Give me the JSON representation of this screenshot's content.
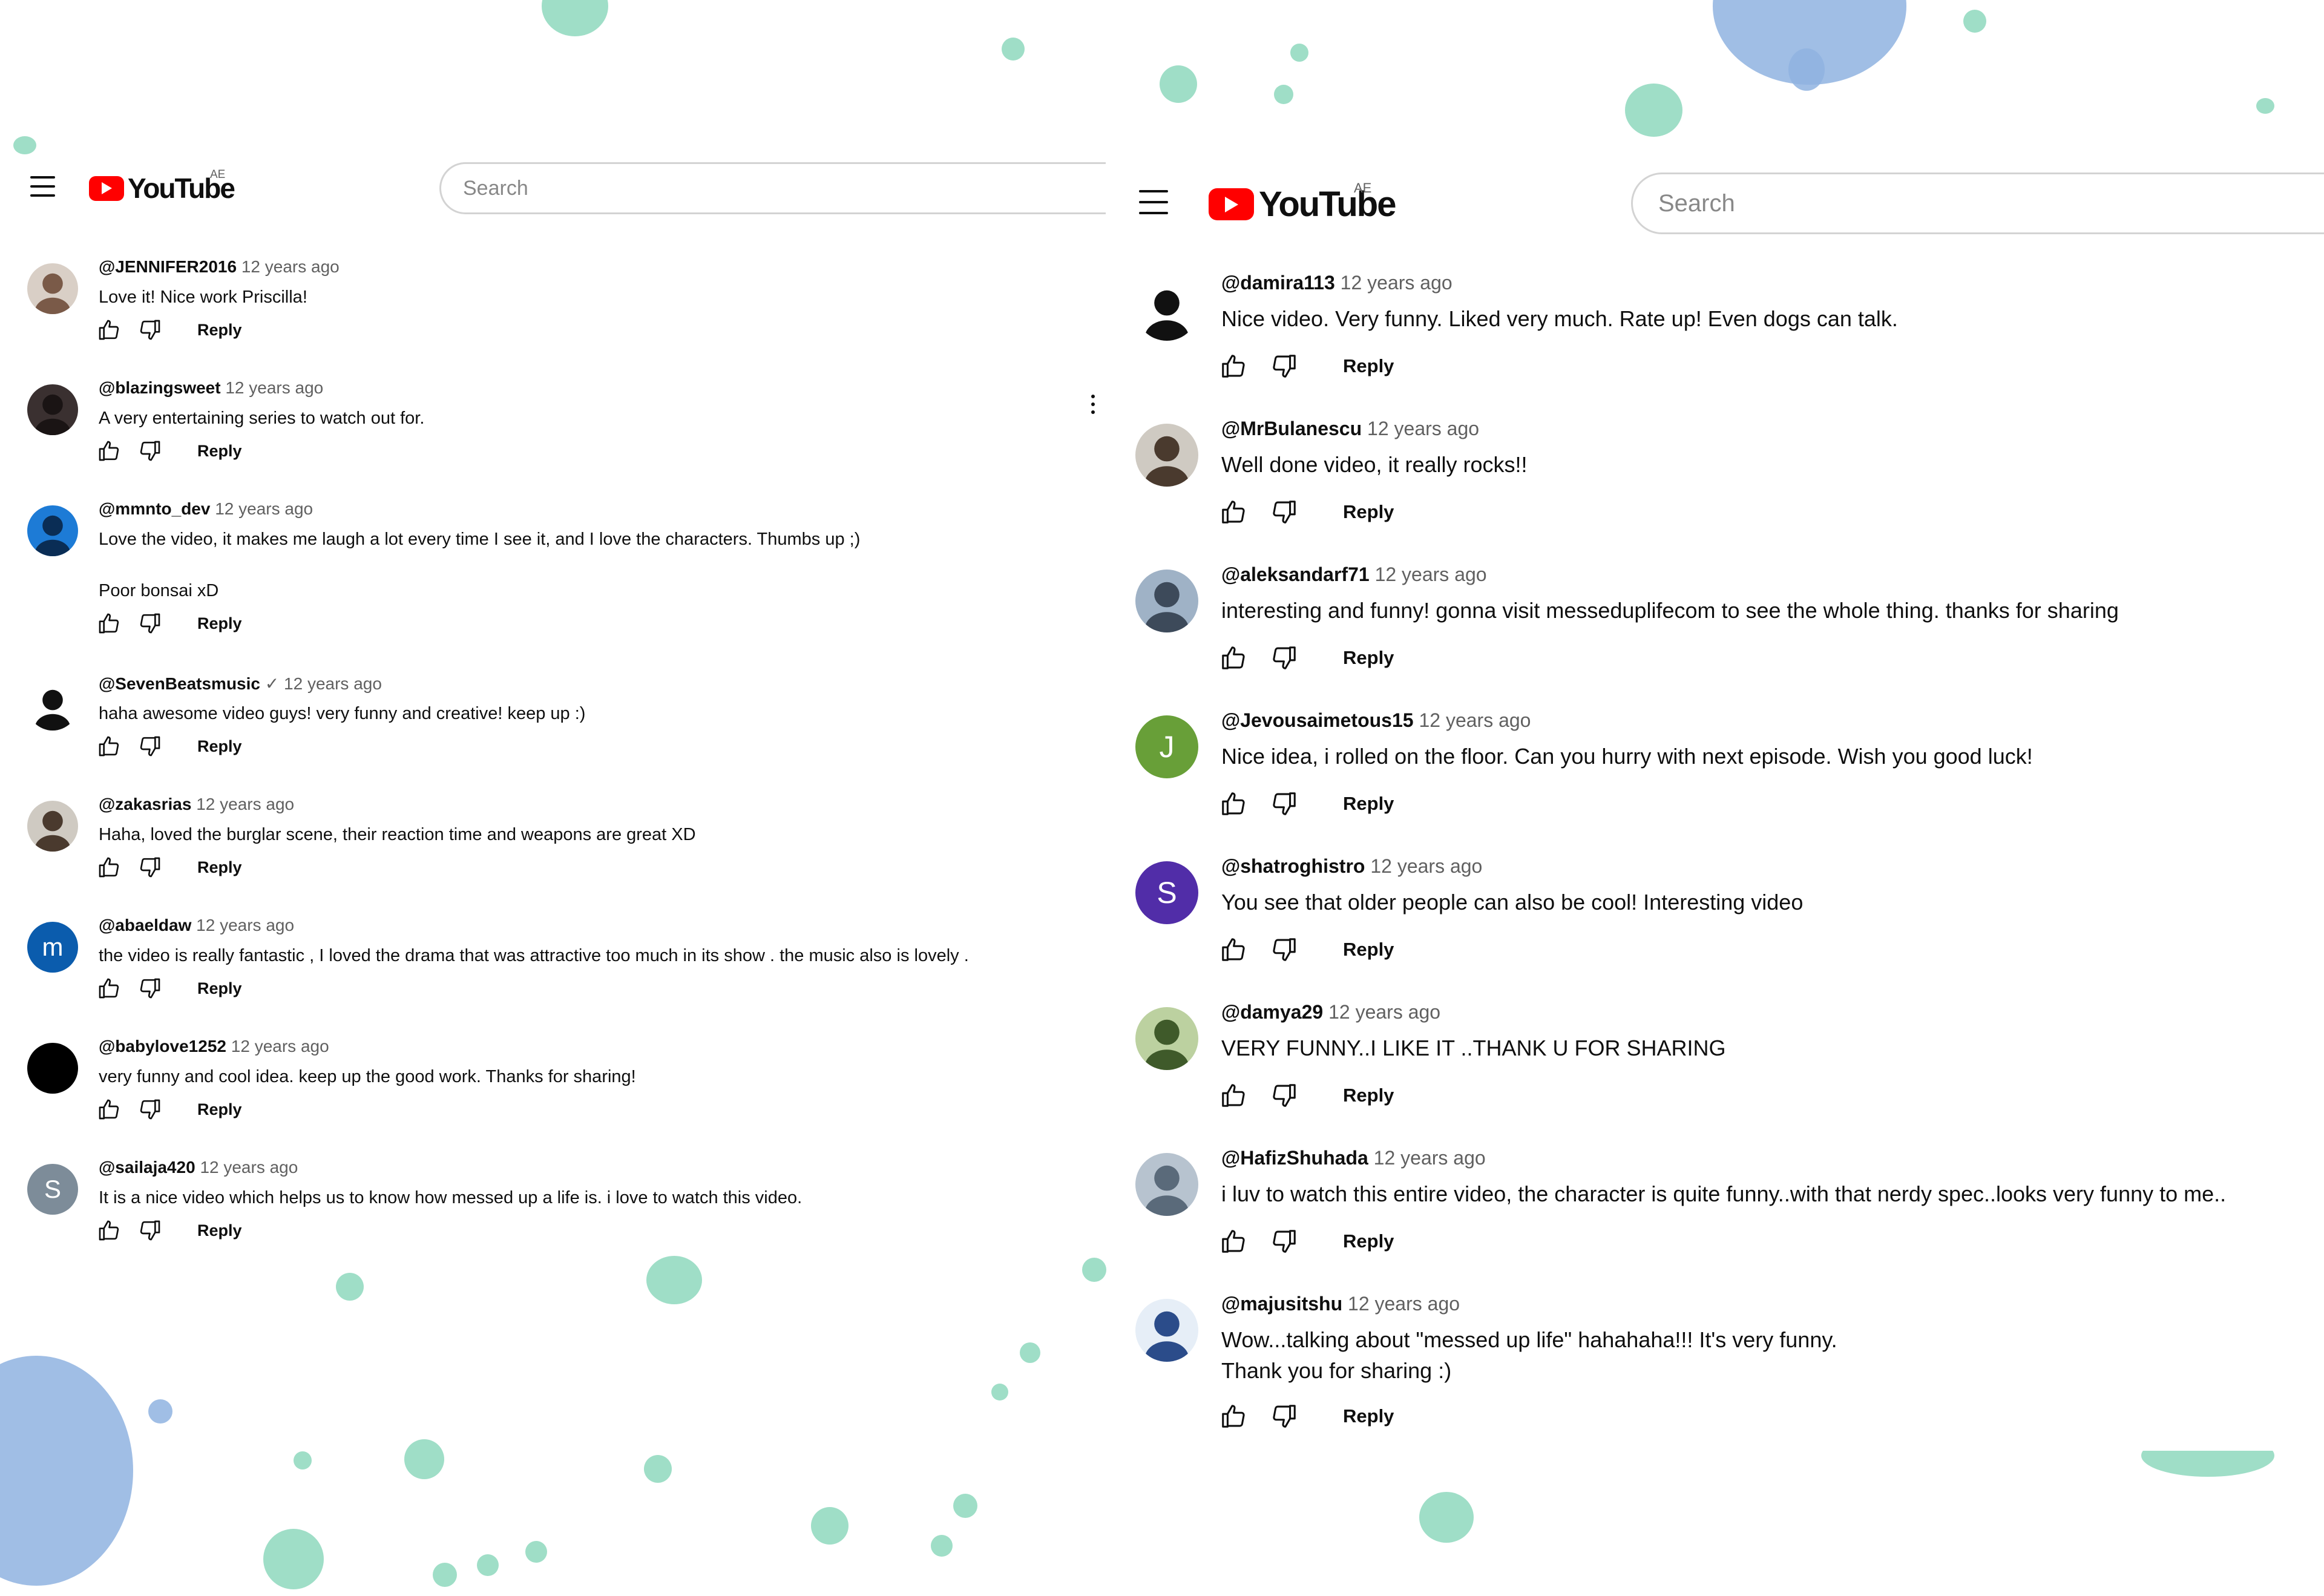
{
  "colors": {
    "brand_red": "#ff0000",
    "splash_green": "#7fd3b4",
    "splash_blue": "#8fb3e0",
    "muted_text": "#606060"
  },
  "left": {
    "header": {
      "logo_text": "YouTube",
      "country": "AE",
      "search_placeholder": "Search",
      "menu_icon": "hamburger-menu-icon"
    },
    "reply_label": "Reply",
    "comments": [
      {
        "author": "@JENNIFER2016",
        "time": "12 years ago",
        "text": "Love it! Nice work Priscilla!"
      },
      {
        "author": "@blazingsweet",
        "time": "12 years ago",
        "text": "A very entertaining series to watch out for."
      },
      {
        "author": "@mmnto_dev",
        "time": "12 years ago",
        "text": "Love the video, it makes me laugh a lot every time I see it,  and I love the characters. Thumbs up ;)",
        "text2": "Poor bonsai xD"
      },
      {
        "author": "@SevenBeatsmusic",
        "verified_icon": "checkmark-icon",
        "time": "12 years ago",
        "text": "haha awesome video guys! very funny and creative! keep up :)"
      },
      {
        "author": "@zakasrias",
        "time": "12 years ago",
        "text": "Haha, loved the burglar scene, their reaction time and weapons are great XD"
      },
      {
        "author": "@abaeldaw",
        "time": "12 years ago",
        "text": "the video is really fantastic , I loved the drama that was attractive too much in its show . the music also is lovely .",
        "initial": "m",
        "color": "#0b5cad"
      },
      {
        "author": "@babylove1252",
        "time": "12 years ago",
        "text": "very funny and cool idea. keep up the good work. Thanks for sharing!",
        "color": "#000000"
      },
      {
        "author": "@sailaja420",
        "time": "12 years ago",
        "text": "It is a nice video which helps us to know how messed up a life is. i love to watch this video.",
        "initial": "S",
        "color": "#7d8c99"
      }
    ]
  },
  "right": {
    "header": {
      "logo_text": "YouTube",
      "country": "AE",
      "search_placeholder": "Search",
      "menu_icon": "hamburger-menu-icon"
    },
    "reply_label": "Reply",
    "comments": [
      {
        "author": "@damira113",
        "time": "12 years ago",
        "text": "Nice video. Very funny. Liked very much. Rate up! Even dogs can talk."
      },
      {
        "author": "@MrBulanescu",
        "time": "12 years ago",
        "text": "Well done video, it really rocks!!"
      },
      {
        "author": "@aleksandarf71",
        "time": "12 years ago",
        "text": "interesting and funny! gonna visit messeduplifecom to see the whole thing. thanks for sharing"
      },
      {
        "author": "@Jevousaimetous15",
        "time": "12 years ago",
        "text": "Nice idea, i rolled on the floor. Can you hurry with next episode. Wish you good luck!",
        "initial": "J",
        "color": "#689f38"
      },
      {
        "author": "@shatroghistro",
        "time": "12 years ago",
        "text": "You see that older people can also be cool! Interesting video",
        "initial": "S",
        "color": "#512da8"
      },
      {
        "author": "@damya29",
        "time": "12 years ago",
        "text": "VERY FUNNY..I LIKE IT ..THANK U FOR SHARING"
      },
      {
        "author": "@HafizShuhada",
        "time": "12 years ago",
        "text": "i luv to watch this entire video, the character is quite funny..with that nerdy spec..looks very funny to me.."
      },
      {
        "author": "@majusitshu",
        "time": "12 years ago",
        "text": "Wow...talking about \"messed up life\" hahahaha!!! It's very funny.",
        "text2": "Thank you for sharing :)"
      }
    ]
  }
}
